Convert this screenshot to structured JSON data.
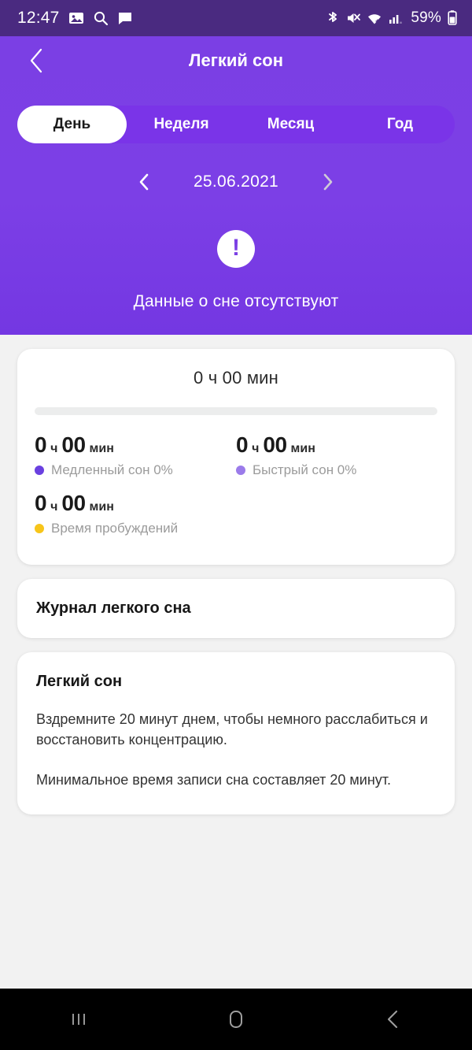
{
  "status_bar": {
    "time": "12:47",
    "left_icons": [
      "image-icon",
      "search-icon",
      "chat-bubble-icon"
    ],
    "right_icons": [
      "bluetooth-icon",
      "volume-mute-icon",
      "wifi-icon",
      "cellular-signal-icon"
    ],
    "battery_percent": "59%",
    "background_color": "#4a2a80"
  },
  "header": {
    "title": "Легкий сон",
    "back_icon": "chevron-left-icon",
    "background_color": "#7b3fe4",
    "tabs": [
      {
        "label": "День",
        "active": true
      },
      {
        "label": "Неделя",
        "active": false
      },
      {
        "label": "Месяц",
        "active": false
      },
      {
        "label": "Год",
        "active": false
      }
    ],
    "date_nav": {
      "prev_icon": "chevron-left-icon",
      "date": "25.06.2021",
      "next_icon": "chevron-right-icon"
    },
    "empty_state": {
      "icon": "exclamation-circle-icon",
      "message": "Данные о сне отсутствуют"
    }
  },
  "stats_card": {
    "total_time": "0 ч 00 мин",
    "progress_percent": 0,
    "items": [
      {
        "hours": "0",
        "hours_unit": "ч",
        "minutes": "00",
        "minutes_unit": "мин",
        "label": "Медленный сон 0%",
        "dot_color": "#6a40e0"
      },
      {
        "hours": "0",
        "hours_unit": "ч",
        "minutes": "00",
        "minutes_unit": "мин",
        "label": "Быстрый сон 0%",
        "dot_color": "#9b7bea"
      },
      {
        "hours": "0",
        "hours_unit": "ч",
        "minutes": "00",
        "minutes_unit": "мин",
        "label": "Время пробуждений",
        "dot_color": "#f7c51a"
      }
    ]
  },
  "journal_card": {
    "title": "Журнал легкого сна"
  },
  "info_card": {
    "title": "Легкий сон",
    "paragraph1": "Вздремните 20 минут днем, чтобы немного расслабиться и восстановить концентрацию.",
    "paragraph2": "Минимальное время записи сна составляет 20 минут."
  },
  "nav_bar": {
    "recents_icon": "recents-icon",
    "home_icon": "home-icon",
    "back_icon": "back-icon"
  }
}
